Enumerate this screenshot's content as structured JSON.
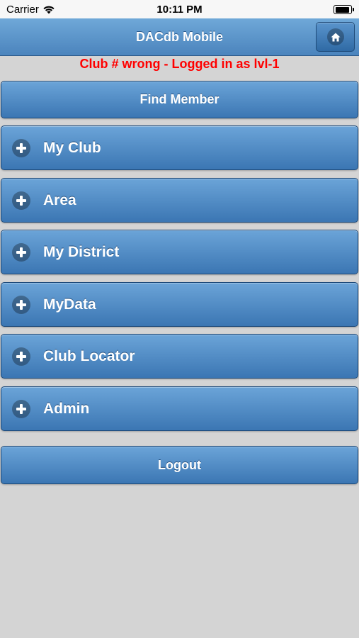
{
  "status_bar": {
    "carrier": "Carrier",
    "time": "10:11 PM",
    "wifi_icon": "wifi-icon",
    "battery_icon": "battery-icon"
  },
  "header": {
    "title": "DACdb Mobile",
    "home_icon": "home-icon"
  },
  "warning": {
    "text": "Club # wrong - Logged in as lvl-1",
    "color": "#ff0000"
  },
  "find_member": {
    "label": "Find Member"
  },
  "menu": {
    "items": [
      {
        "label": "My Club",
        "icon": "plus-icon"
      },
      {
        "label": "Area",
        "icon": "plus-icon"
      },
      {
        "label": "My District",
        "icon": "plus-icon"
      },
      {
        "label": "MyData",
        "icon": "plus-icon"
      },
      {
        "label": "Club Locator",
        "icon": "plus-icon"
      },
      {
        "label": "Admin",
        "icon": "plus-icon"
      }
    ]
  },
  "logout": {
    "label": "Logout"
  },
  "colors": {
    "button_top": "#6ba4d8",
    "button_bottom": "#3b76b3",
    "background": "#d4d4d4"
  }
}
